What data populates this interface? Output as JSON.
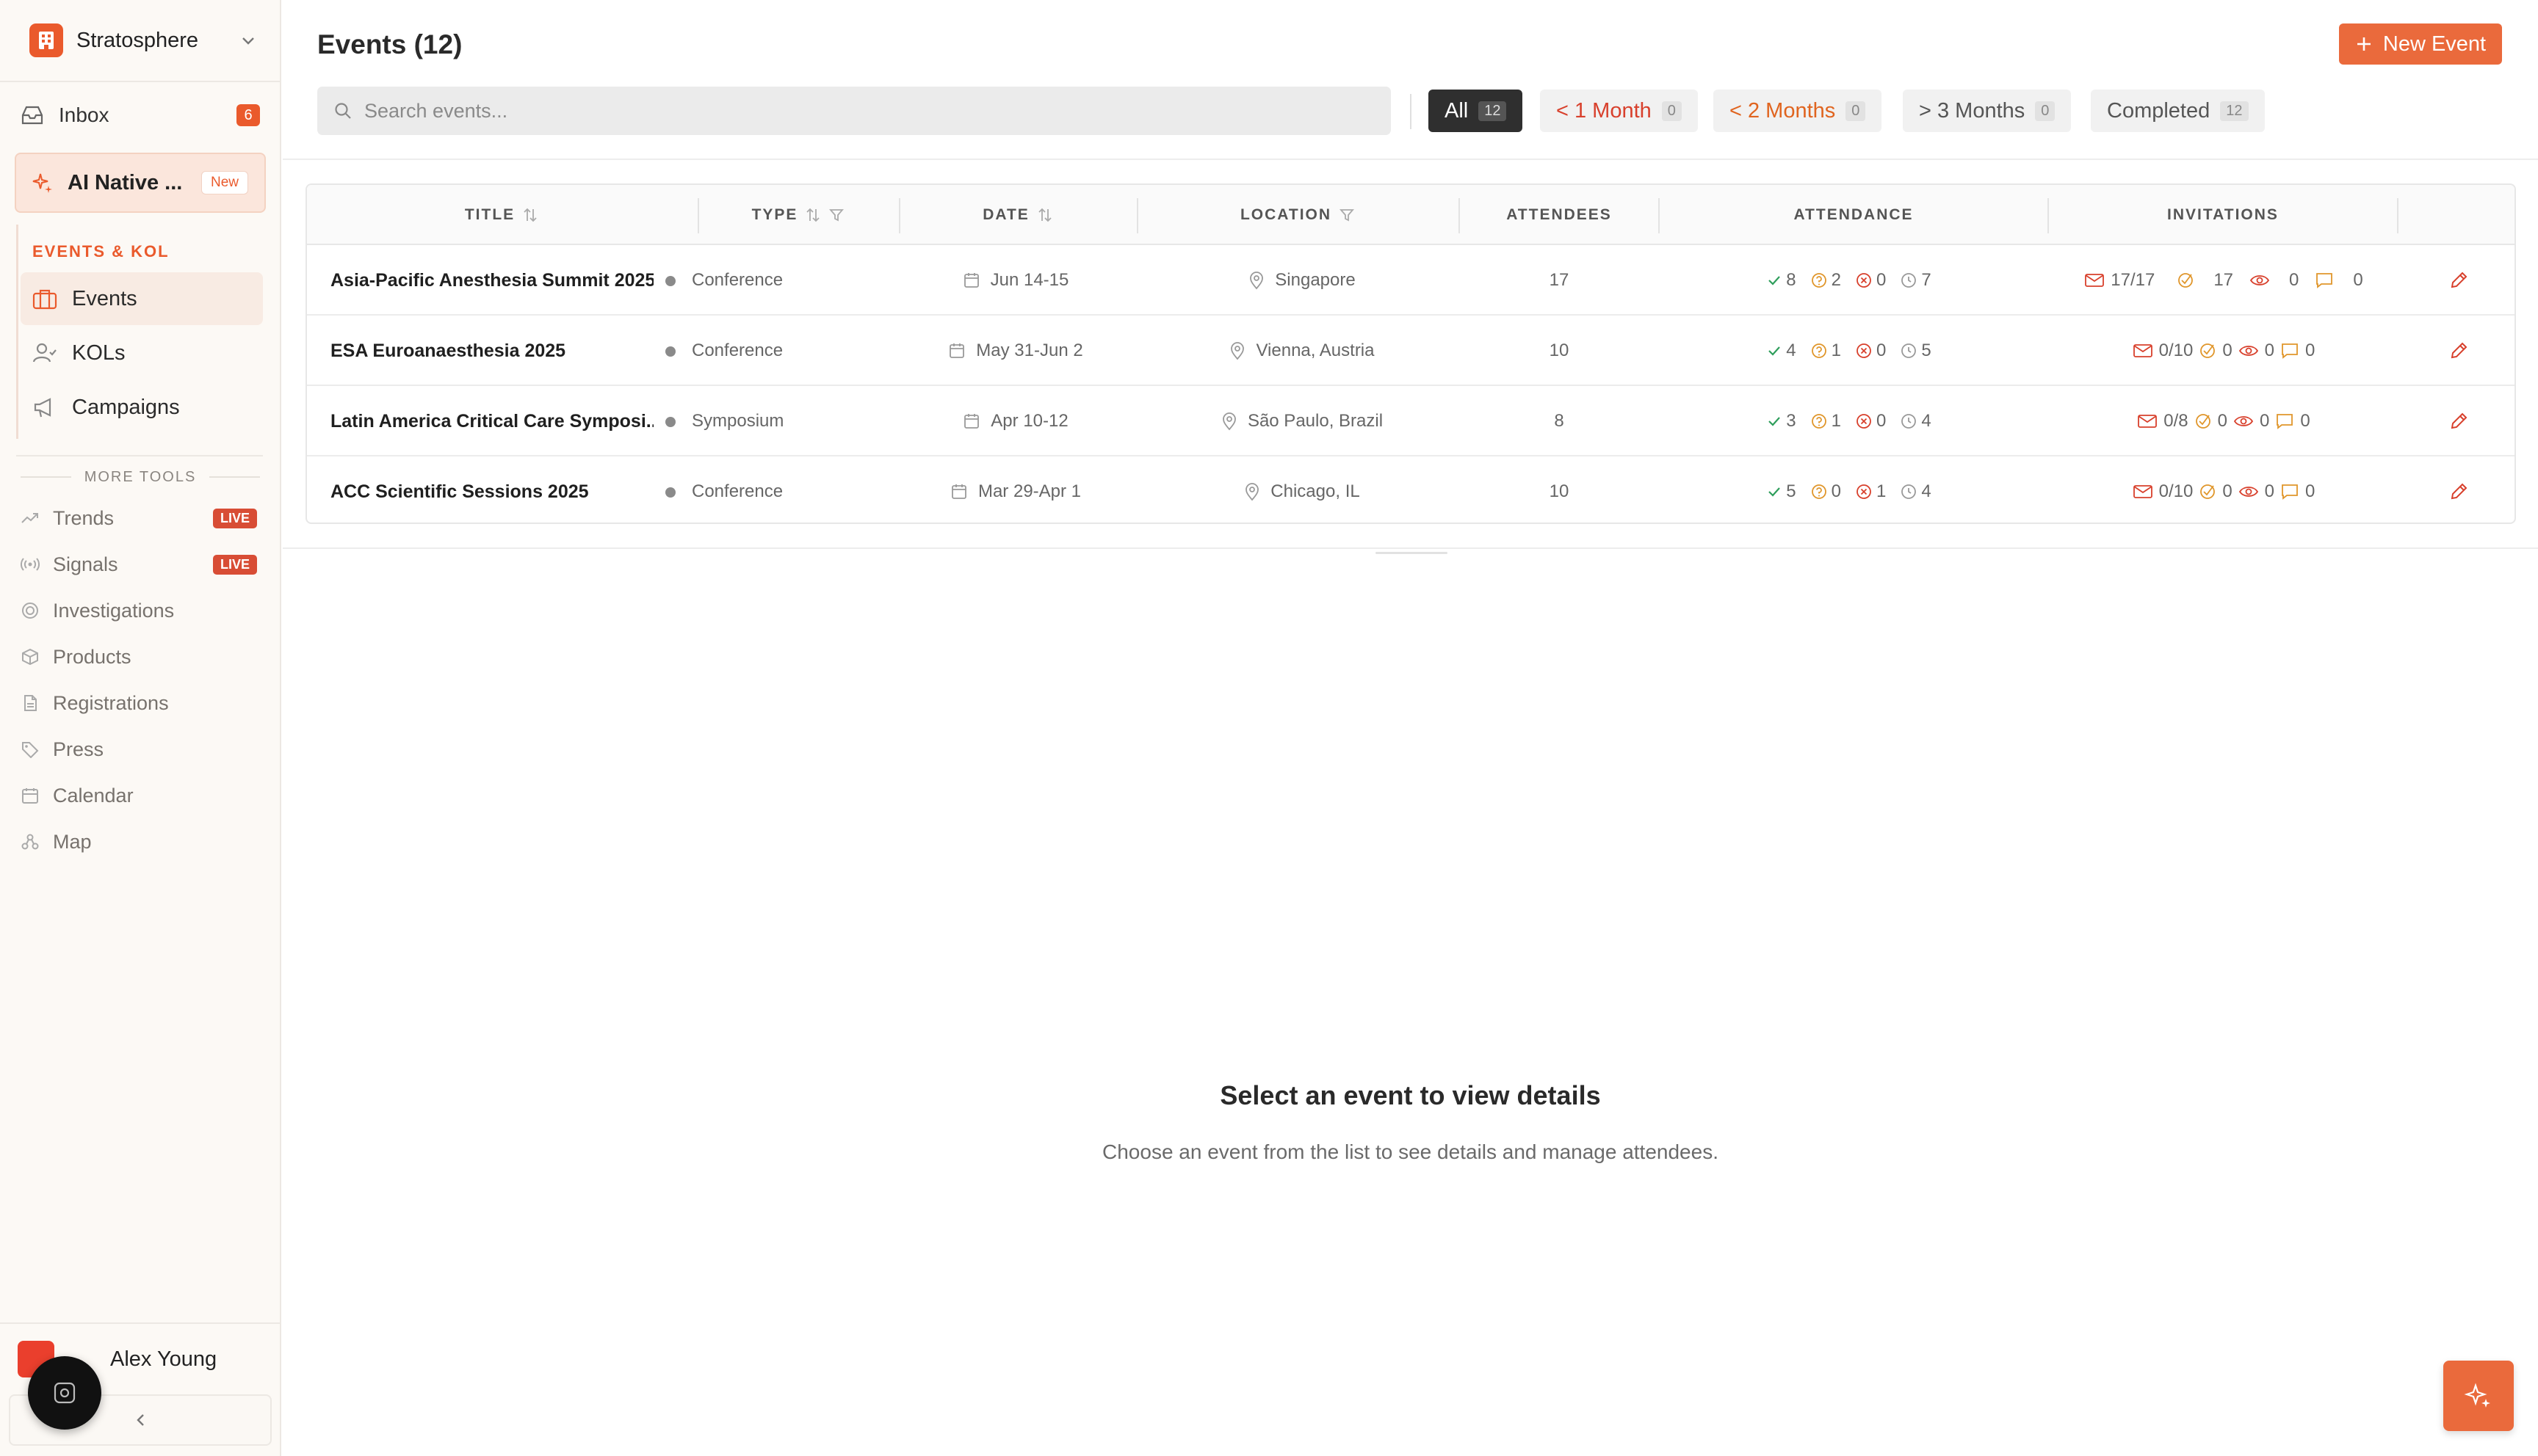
{
  "sidebar": {
    "workspace": "Stratosphere",
    "inbox": {
      "label": "Inbox",
      "count": "6"
    },
    "ai_native": {
      "label": "AI Native ...",
      "badge": "New"
    },
    "group_title": "EVENTS & KOL",
    "nav": [
      {
        "label": "Events",
        "icon": "briefcase-icon"
      },
      {
        "label": "KOLs",
        "icon": "user-check-icon"
      },
      {
        "label": "Campaigns",
        "icon": "megaphone-icon"
      }
    ],
    "more_tools_label": "MORE TOOLS",
    "tools": [
      {
        "label": "Trends",
        "badge": "LIVE",
        "icon": "trend-icon"
      },
      {
        "label": "Signals",
        "badge": "LIVE",
        "icon": "signal-icon"
      },
      {
        "label": "Investigations",
        "icon": "target-icon"
      },
      {
        "label": "Products",
        "icon": "box-icon"
      },
      {
        "label": "Registrations",
        "icon": "document-icon"
      },
      {
        "label": "Press",
        "icon": "tag-icon"
      },
      {
        "label": "Calendar",
        "icon": "calendar-icon"
      },
      {
        "label": "Map",
        "icon": "map-icon"
      }
    ],
    "user": {
      "name": "Alex Young"
    }
  },
  "header": {
    "title": "Events (12)",
    "new_event_label": "New Event"
  },
  "search": {
    "placeholder": "Search events...",
    "value": ""
  },
  "filters": [
    {
      "label": "All",
      "count": "12",
      "state": "active"
    },
    {
      "label": "< 1 Month",
      "count": "0",
      "color": "red"
    },
    {
      "label": "< 2 Months",
      "count": "0",
      "color": "orange"
    },
    {
      "label": "> 3 Months",
      "count": "0",
      "color": "gray"
    },
    {
      "label": "Completed",
      "count": "12",
      "color": "gray"
    }
  ],
  "table": {
    "columns": [
      "TITLE",
      "TYPE",
      "DATE",
      "LOCATION",
      "ATTENDEES",
      "ATTENDANCE",
      "INVITATIONS"
    ],
    "rows": [
      {
        "title": "Asia-Pacific Anesthesia Summit 2025",
        "type": "Conference",
        "date": "Jun 14-15",
        "location": "Singapore",
        "attendees": "17",
        "attendance": {
          "confirmed": "8",
          "maybe": "2",
          "declined": "0",
          "pending": "7"
        },
        "invitations": {
          "sent": "17/17",
          "accepted": "17",
          "viewed": "0",
          "replied": "0"
        }
      },
      {
        "title": "ESA Euroanaesthesia 2025",
        "type": "Conference",
        "date": "May 31-Jun 2",
        "location": "Vienna, Austria",
        "attendees": "10",
        "attendance": {
          "confirmed": "4",
          "maybe": "1",
          "declined": "0",
          "pending": "5"
        },
        "invitations": {
          "sent": "0/10",
          "accepted": "0",
          "viewed": "0",
          "replied": "0"
        }
      },
      {
        "title": "Latin America Critical Care Symposi...",
        "type": "Symposium",
        "date": "Apr 10-12",
        "location": "São Paulo, Brazil",
        "attendees": "8",
        "attendance": {
          "confirmed": "3",
          "maybe": "1",
          "declined": "0",
          "pending": "4"
        },
        "invitations": {
          "sent": "0/8",
          "accepted": "0",
          "viewed": "0",
          "replied": "0"
        }
      },
      {
        "title": "ACC Scientific Sessions 2025",
        "type": "Conference",
        "date": "Mar 29-Apr 1",
        "location": "Chicago, IL",
        "attendees": "10",
        "attendance": {
          "confirmed": "5",
          "maybe": "0",
          "declined": "1",
          "pending": "4"
        },
        "invitations": {
          "sent": "0/10",
          "accepted": "0",
          "viewed": "0",
          "replied": "0"
        }
      }
    ]
  },
  "empty_state": {
    "title": "Select an event to view details",
    "subtitle": "Choose an event from the list to see details and manage attendees."
  },
  "colors": {
    "accent": "#ea6a3c",
    "brand": "#ea5a2c",
    "green": "#2e9e5b",
    "amber": "#e0962b",
    "red": "#d8402c"
  }
}
